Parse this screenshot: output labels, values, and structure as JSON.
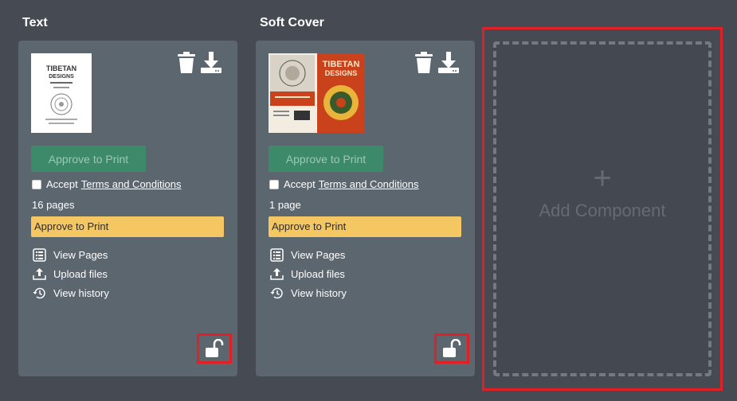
{
  "columns": [
    {
      "title": "Text",
      "thumbnail": {
        "heading": "TIBETAN",
        "subheading": "DESIGNS"
      },
      "approve_button": "Approve to Print",
      "accept_prefix": "Accept",
      "accept_terms": "Terms and Conditions",
      "page_count": "16 pages",
      "status": "Approve to Print",
      "actions": [
        "View Pages",
        "Upload files",
        "View history"
      ]
    },
    {
      "title": "Soft Cover",
      "thumbnail": {
        "heading": "TIBETAN",
        "subheading": "DESIGNS"
      },
      "approve_button": "Approve to Print",
      "accept_prefix": "Accept",
      "accept_terms": "Terms and Conditions",
      "page_count": "1 page",
      "status": "Approve to Print",
      "actions": [
        "View Pages",
        "Upload files",
        "View history"
      ]
    }
  ],
  "add_component": {
    "icon": "+",
    "label": "Add Component"
  },
  "icons": {
    "trash": "trash-icon",
    "download": "download-icon",
    "view_pages": "list-icon",
    "upload": "upload-icon",
    "history": "history-icon",
    "lock": "unlock-icon"
  },
  "colors": {
    "background": "#464a52",
    "card": "#5c666f",
    "approve_button": "#3c8a6a",
    "status_banner": "#f4c763",
    "highlight": "#e02024"
  }
}
